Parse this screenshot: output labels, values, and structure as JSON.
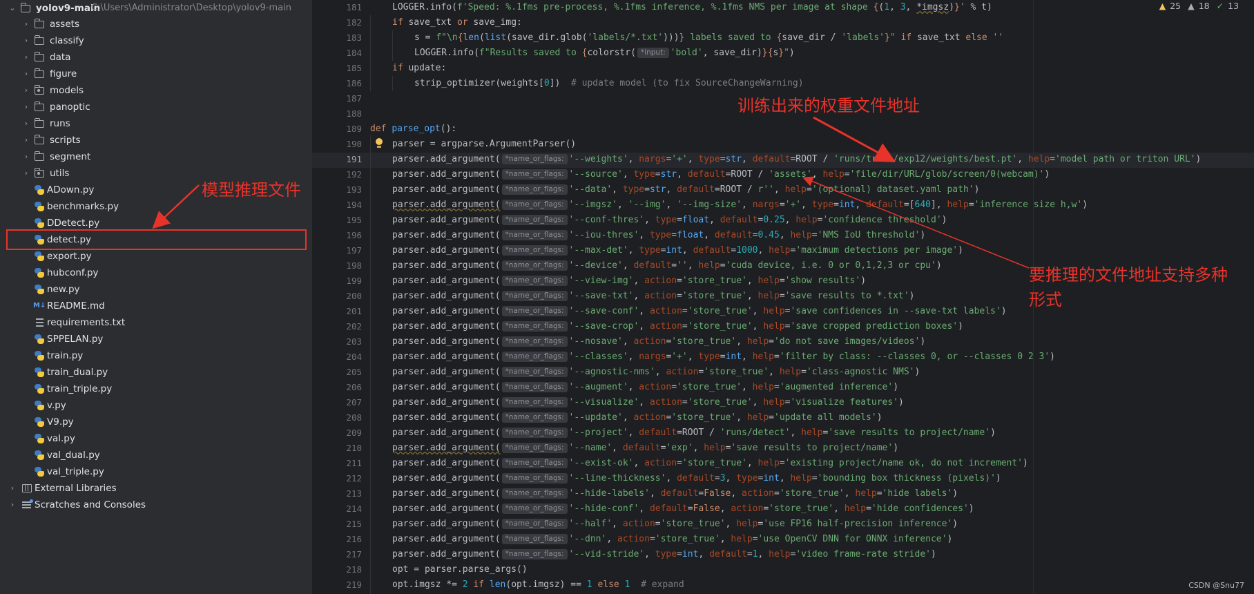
{
  "project": {
    "root_name": "yolov9-main",
    "root_path": "C:\\Users\\Administrator\\Desktop\\yolov9-main",
    "folders": [
      "assets",
      "classify",
      "data",
      "figure",
      "models",
      "panoptic",
      "runs",
      "scripts",
      "segment",
      "utils"
    ],
    "files": [
      "ADown.py",
      "benchmarks.py",
      "DDetect.py",
      "detect.py",
      "export.py",
      "hubconf.py",
      "new.py",
      "README.md",
      "requirements.txt",
      "SPPELAN.py",
      "train.py",
      "train_dual.py",
      "train_triple.py",
      "v.py",
      "V9.py",
      "val.py",
      "val_dual.py",
      "val_triple.py"
    ],
    "external_libraries": "External Libraries",
    "scratches": "Scratches and Consoles",
    "selected_file": "detect.py"
  },
  "editor": {
    "line_numbers": [
      "181",
      "182",
      "183",
      "184",
      "185",
      "186",
      "187",
      "188",
      "189",
      "190",
      "191",
      "192",
      "193",
      "194",
      "195",
      "196",
      "197",
      "198",
      "199",
      "200",
      "201",
      "202",
      "203",
      "204",
      "205",
      "206",
      "207",
      "208",
      "209",
      "210",
      "211",
      "212",
      "213",
      "214",
      "215",
      "216",
      "217",
      "218",
      "219"
    ],
    "current_line": "191",
    "param_hint": "*name_or_flags:",
    "input_hint": "*input:",
    "inspections": {
      "warnings": "25",
      "weak_warnings": "18",
      "ok": "13"
    }
  },
  "annotations": {
    "model_infer_file": "模型推理文件",
    "trained_weights_path": "训练出来的权重文件地址",
    "source_path_line1": "要推理的文件地址支持多种",
    "source_path_line2": "形式"
  },
  "watermark": "CSDN @Snu77"
}
